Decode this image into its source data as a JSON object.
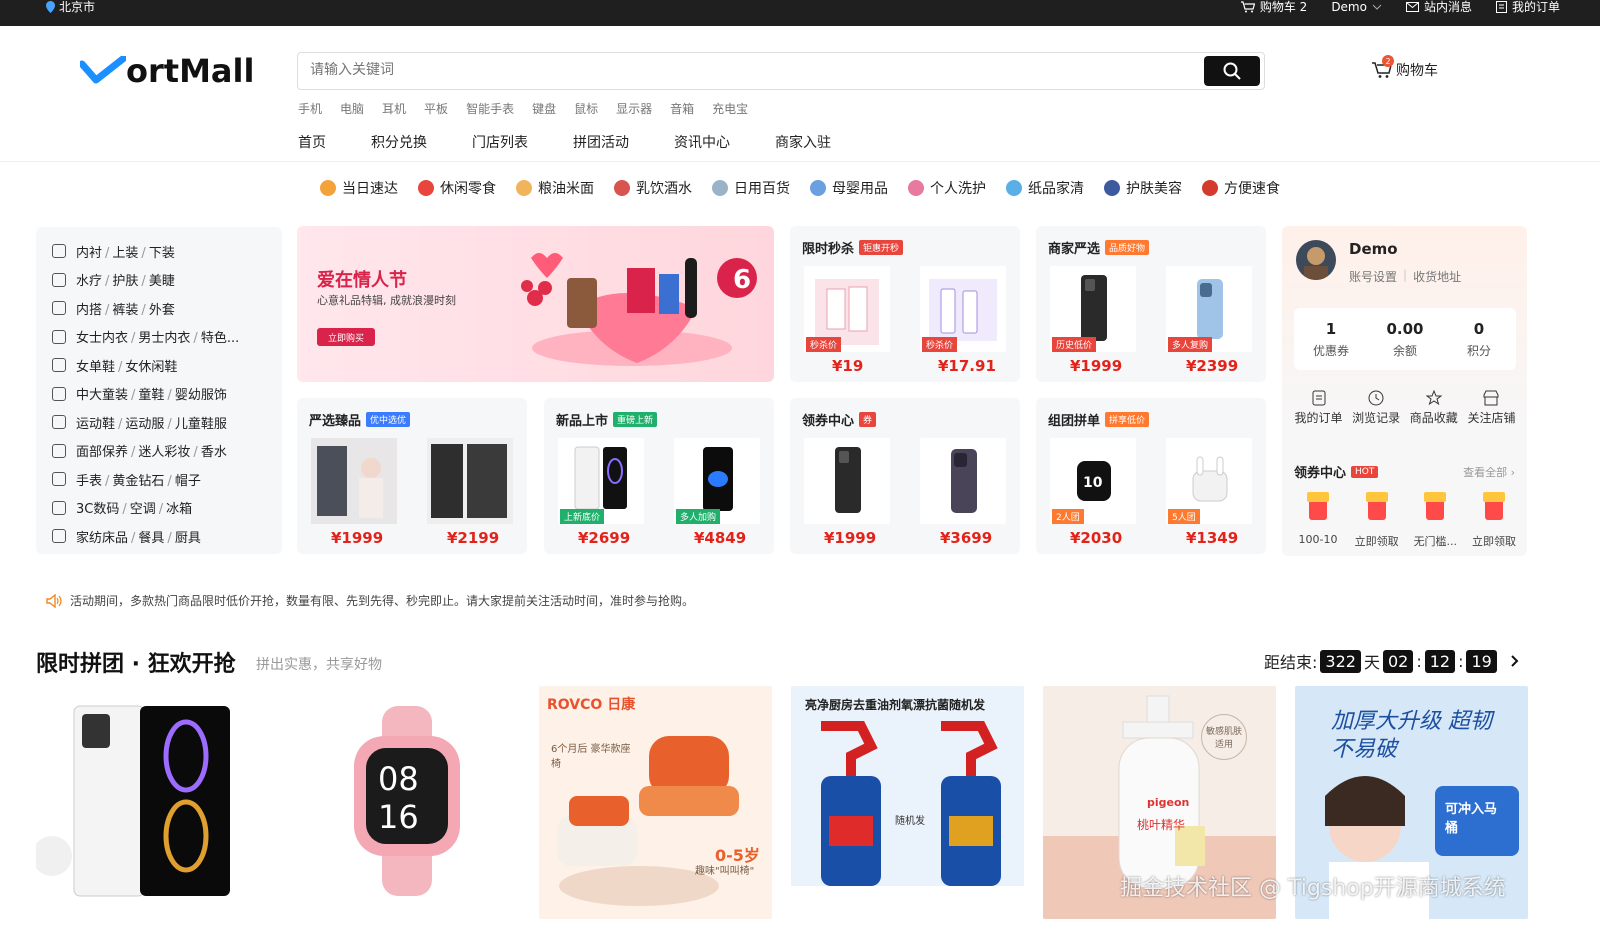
{
  "topbar": {
    "location": "北京市",
    "cart": "购物车 2",
    "user": "Demo",
    "messages": "站内消息",
    "orders": "我的订单"
  },
  "header": {
    "logo": "ortMall",
    "search_placeholder": "请输入关键词",
    "hotwords": [
      "手机",
      "电脑",
      "耳机",
      "平板",
      "智能手表",
      "键盘",
      "鼠标",
      "显示器",
      "音箱",
      "充电宝"
    ],
    "nav": [
      "首页",
      "积分兑换",
      "门店列表",
      "拼团活动",
      "资讯中心",
      "商家入驻"
    ],
    "cart_label": "购物车",
    "cart_count": "2"
  },
  "categories": [
    {
      "label": "当日速达",
      "color": "#f4a23a"
    },
    {
      "label": "休闲零食",
      "color": "#e8453c"
    },
    {
      "label": "粮油米面",
      "color": "#f0b45a"
    },
    {
      "label": "乳饮酒水",
      "color": "#d9534f"
    },
    {
      "label": "日用百货",
      "color": "#9ab3c9"
    },
    {
      "label": "母婴用品",
      "color": "#6aa0e0"
    },
    {
      "label": "个人洗护",
      "color": "#e87aa0"
    },
    {
      "label": "纸品家清",
      "color": "#5ab0e6"
    },
    {
      "label": "护肤美容",
      "color": "#3d5a9e"
    },
    {
      "label": "方便速食",
      "color": "#d33b2c"
    }
  ],
  "sidebar": [
    [
      "内衬",
      "上装",
      "下装"
    ],
    [
      "水疗",
      "护肤",
      "美睫"
    ],
    [
      "内搭",
      "裤装",
      "外套"
    ],
    [
      "女士内衣",
      "男士内衣",
      "特色..."
    ],
    [
      "女单鞋",
      "女休闲鞋"
    ],
    [
      "中大童装",
      "童鞋",
      "婴幼服饰"
    ],
    [
      "运动鞋",
      "运动服",
      "儿童鞋服"
    ],
    [
      "面部保养",
      "迷人彩妆",
      "香水"
    ],
    [
      "手表",
      "黄金钻石",
      "帽子"
    ],
    [
      "3C数码",
      "空调",
      "冰箱"
    ],
    [
      "家纺床品",
      "餐具",
      "厨具"
    ]
  ],
  "banner": {
    "title": "爱在情人节",
    "subtitle": "心意礼品特辑, 成就浪漫时刻",
    "button": "立即购买",
    "badge": "6"
  },
  "cards": {
    "flash": {
      "title": "限时秒杀",
      "tag": "钜惠开秒",
      "items": [
        {
          "price": "¥19",
          "label": "秒杀价"
        },
        {
          "price": "¥17.91",
          "label": "秒杀价"
        }
      ]
    },
    "merchant": {
      "title": "商家严选",
      "tag": "品质好物",
      "items": [
        {
          "price": "¥1999",
          "label": "历史低价"
        },
        {
          "price": "¥2399",
          "label": "多人复购"
        }
      ]
    },
    "select": {
      "title": "严选臻品",
      "tag": "优中选优",
      "items": [
        {
          "price": "¥1999"
        },
        {
          "price": "¥2199"
        }
      ]
    },
    "new": {
      "title": "新品上市",
      "tag": "重磅上新",
      "items": [
        {
          "price": "¥2699",
          "label": "上新底价"
        },
        {
          "price": "¥4849",
          "label": "多人加购"
        }
      ]
    },
    "coupon": {
      "title": "领券中心",
      "tag": "券",
      "items": [
        {
          "price": "¥1999"
        },
        {
          "price": "¥3699"
        }
      ]
    },
    "group": {
      "title": "组团拼单",
      "tag": "拼享低价",
      "items": [
        {
          "price": "¥2030",
          "label": "2人团"
        },
        {
          "price": "¥1349",
          "label": "5人团"
        }
      ]
    }
  },
  "user": {
    "name": "Demo",
    "links": [
      "账号设置",
      "收货地址"
    ],
    "stats": [
      {
        "value": "1",
        "label": "优惠券"
      },
      {
        "value": "0.00",
        "label": "余额"
      },
      {
        "value": "0",
        "label": "积分"
      }
    ],
    "shortcuts": [
      "我的订单",
      "浏览记录",
      "商品收藏",
      "关注店铺"
    ],
    "coupon_title": "领券中心",
    "coupon_tag": "HOT",
    "view_all": "查看全部",
    "coupons": [
      "100-10",
      "立即领取",
      "无门槛...",
      "立即领取"
    ]
  },
  "notice": "活动期间，多款热门商品限时低价开抢，数量有限、先到先得、秒完即止。请大家提前关注活动时间，准时参与抢购。",
  "group_section": {
    "title": "限时拼团 · 狂欢开抢",
    "subtitle": "拼出实惠，共享好物",
    "countdown_label": "距结束:",
    "days": "322",
    "day_unit": "天",
    "hours": "02",
    "minutes": "12",
    "seconds": "19"
  },
  "goods": [
    {
      "name": "phone"
    },
    {
      "name": "watch",
      "text": "08\n16"
    },
    {
      "name": "chair",
      "brand": "ROVCO 日康",
      "caption": "6个月后 豪华款座椅",
      "age": "0-5岁",
      "sub": "趣味\"叫叫椅\""
    },
    {
      "name": "cleaner",
      "caption": "亮净厨房去重油剂氧漂抗菌随机发",
      "mid": "随机发"
    },
    {
      "name": "wash",
      "brand": "pigeon",
      "product": "桃叶精华",
      "tag": "敏感肌肤适用"
    },
    {
      "name": "tissue",
      "caption": "加厚大升级 超韧不易破",
      "side": "可冲入马桶"
    }
  ],
  "watermark": "掘金技术社区 @ Tigshop开源商城系统"
}
